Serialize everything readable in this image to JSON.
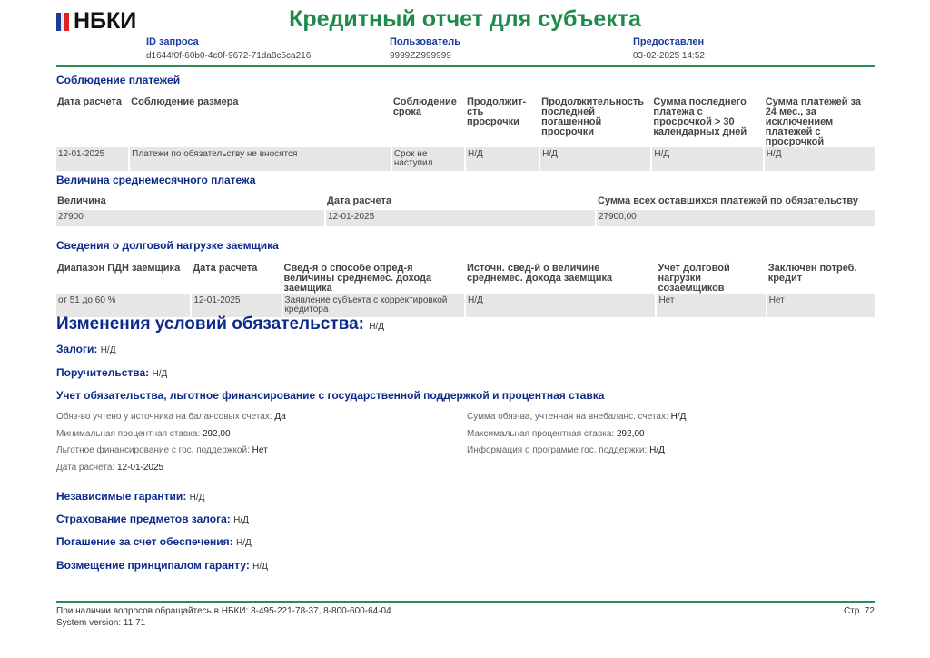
{
  "header": {
    "logo": "НБКИ",
    "title": "Кредитный отчет для субъекта",
    "fields": [
      {
        "label": "ID запроса",
        "value": "d1644f0f-60b0-4c0f-9672-71da8c5ca216"
      },
      {
        "label": "Пользователь",
        "value": "9999ZZ999999"
      },
      {
        "label": "Предоставлен",
        "value": "03-02-2025 14:52"
      }
    ]
  },
  "payments": {
    "title": "Соблюдение платежей",
    "columns": [
      "Дата расчета",
      "Соблюдение размера",
      "Соблюдение срока",
      "Продолжит-сть просрочки",
      "Продолжительность последней погашенной просрочки",
      "Сумма последнего платежа с просрочкой > 30 календарных дней",
      "Сумма платежей за 24 мес., за исключением платежей с просрочкой"
    ],
    "row": [
      "12-01-2025",
      "Платежи по обязательству не вносятся",
      "Срок не наступил",
      "Н/Д",
      "Н/Д",
      "Н/Д",
      "Н/Д"
    ]
  },
  "avg": {
    "title": "Величина среднемесячного платежа",
    "columns": [
      "Величина",
      "Дата расчета",
      "Сумма всех оставшихся платежей по обязательству"
    ],
    "row": [
      "27900",
      "12-01-2025",
      "27900,00"
    ]
  },
  "debt": {
    "title": "Сведения о долговой нагрузке заемщика",
    "columns": [
      "Диапазон ПДН заемщика",
      "Дата расчета",
      "Свед-я о способе опред-я величины среднемес. дохода заемщика",
      "Источн. свед-й о величине среднемес. дохода заемщика",
      "Учет долговой нагрузки созаемщиков",
      "Заключен потреб. кредит"
    ],
    "row": [
      "от 51 до 60 %",
      "12-01-2025",
      "Заявление субъекта с корректировкой кредитора",
      "Н/Д",
      "Нет",
      "Нет"
    ]
  },
  "changes": {
    "title": "Изменения условий обязательства:",
    "value": "Н/Д"
  },
  "pledges": {
    "title": "Залоги:",
    "value": "Н/Д"
  },
  "sureties": {
    "title": "Поручительства:",
    "value": "Н/Д"
  },
  "accounting": {
    "title": "Учет обязательства, льготное финансирование с государственной поддержкой и процентная ставка",
    "left": [
      {
        "label": "Обяз-во учтено у источника на балансовых счетах:",
        "value": "Да"
      },
      {
        "label": "Минимальная процентная ставка:",
        "value": "292,00"
      },
      {
        "label": "Льготное финансирование с гос. поддержкой:",
        "value": "Нет"
      },
      {
        "label": "Дата расчета:",
        "value": "12-01-2025"
      }
    ],
    "right": [
      {
        "label": "Сумма обяз-ва, учтенная на внебаланс. счетах:",
        "value": "Н/Д"
      },
      {
        "label": "Максимальная процентная ставка:",
        "value": "292,00"
      },
      {
        "label": "Информация о программе гос. поддержки:",
        "value": "Н/Д"
      }
    ]
  },
  "guarantees": {
    "title": "Независимые гарантии:",
    "value": "Н/Д"
  },
  "insurance": {
    "title": "Страхование предметов залога:",
    "value": "Н/Д"
  },
  "repayment": {
    "title": "Погашение за счет обеспечения:",
    "value": "Н/Д"
  },
  "reimbursement": {
    "title": "Возмещение принципалом гаранту:",
    "value": "Н/Д"
  },
  "footer": {
    "contact": "При наличии вопросов обращайтесь в НБКИ: 8-495-221-78-37, 8-800-600-64-04",
    "version": "System version: 11.71",
    "page": "Стр. 72"
  }
}
